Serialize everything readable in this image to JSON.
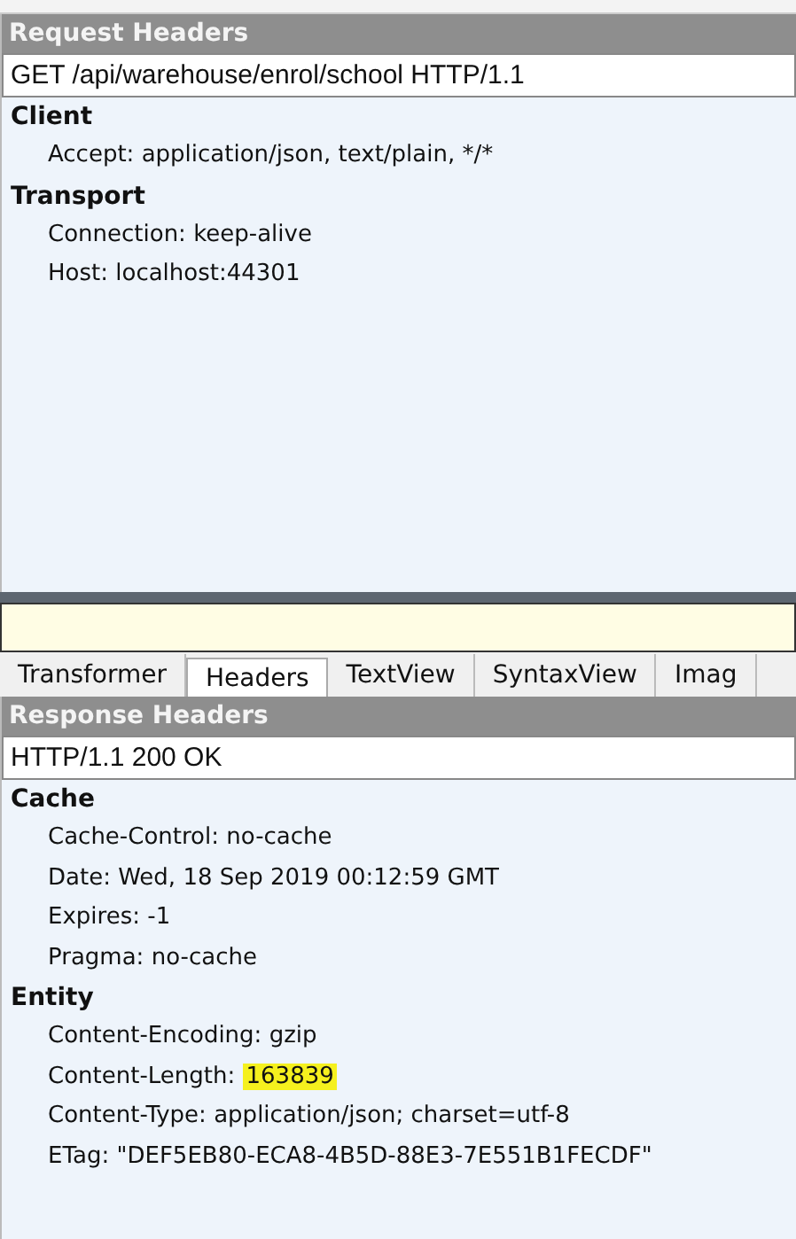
{
  "request": {
    "title": "Request Headers",
    "request_line": "GET /api/warehouse/enrol/school HTTP/1.1",
    "groups": [
      {
        "name": "Client",
        "headers": [
          {
            "name": "Accept:",
            "value": "application/json, text/plain, */*",
            "highlighted": false
          }
        ]
      },
      {
        "name": "Transport",
        "headers": [
          {
            "name": "Connection:",
            "value": "keep-alive",
            "highlighted": false
          },
          {
            "name": "Host:",
            "value": "localhost:44301",
            "highlighted": false
          }
        ]
      }
    ]
  },
  "tabs": [
    {
      "label": "Transformer",
      "selected": false
    },
    {
      "label": "Headers",
      "selected": true
    },
    {
      "label": "TextView",
      "selected": false
    },
    {
      "label": "SyntaxView",
      "selected": false
    },
    {
      "label": "Imag",
      "selected": false
    }
  ],
  "response": {
    "title": "Response Headers",
    "status_line": "HTTP/1.1 200 OK",
    "groups": [
      {
        "name": "Cache",
        "headers": [
          {
            "name": "Cache-Control:",
            "value": "no-cache",
            "highlighted": false
          },
          {
            "name": "Date:",
            "value": "Wed, 18 Sep 2019 00:12:59 GMT",
            "highlighted": false
          },
          {
            "name": "Expires:",
            "value": "-1",
            "highlighted": false
          },
          {
            "name": "Pragma:",
            "value": "no-cache",
            "highlighted": false
          }
        ]
      },
      {
        "name": "Entity",
        "headers": [
          {
            "name": "Content-Encoding:",
            "value": "gzip",
            "highlighted": false
          },
          {
            "name": "Content-Length:",
            "value": "163839",
            "highlighted": true
          },
          {
            "name": "Content-Type:",
            "value": "application/json; charset=utf-8",
            "highlighted": false
          },
          {
            "name": "ETag:",
            "value": "\"DEF5EB80-ECA8-4B5D-88E3-7E551B1FECDF\"",
            "highlighted": false
          }
        ]
      }
    ]
  }
}
